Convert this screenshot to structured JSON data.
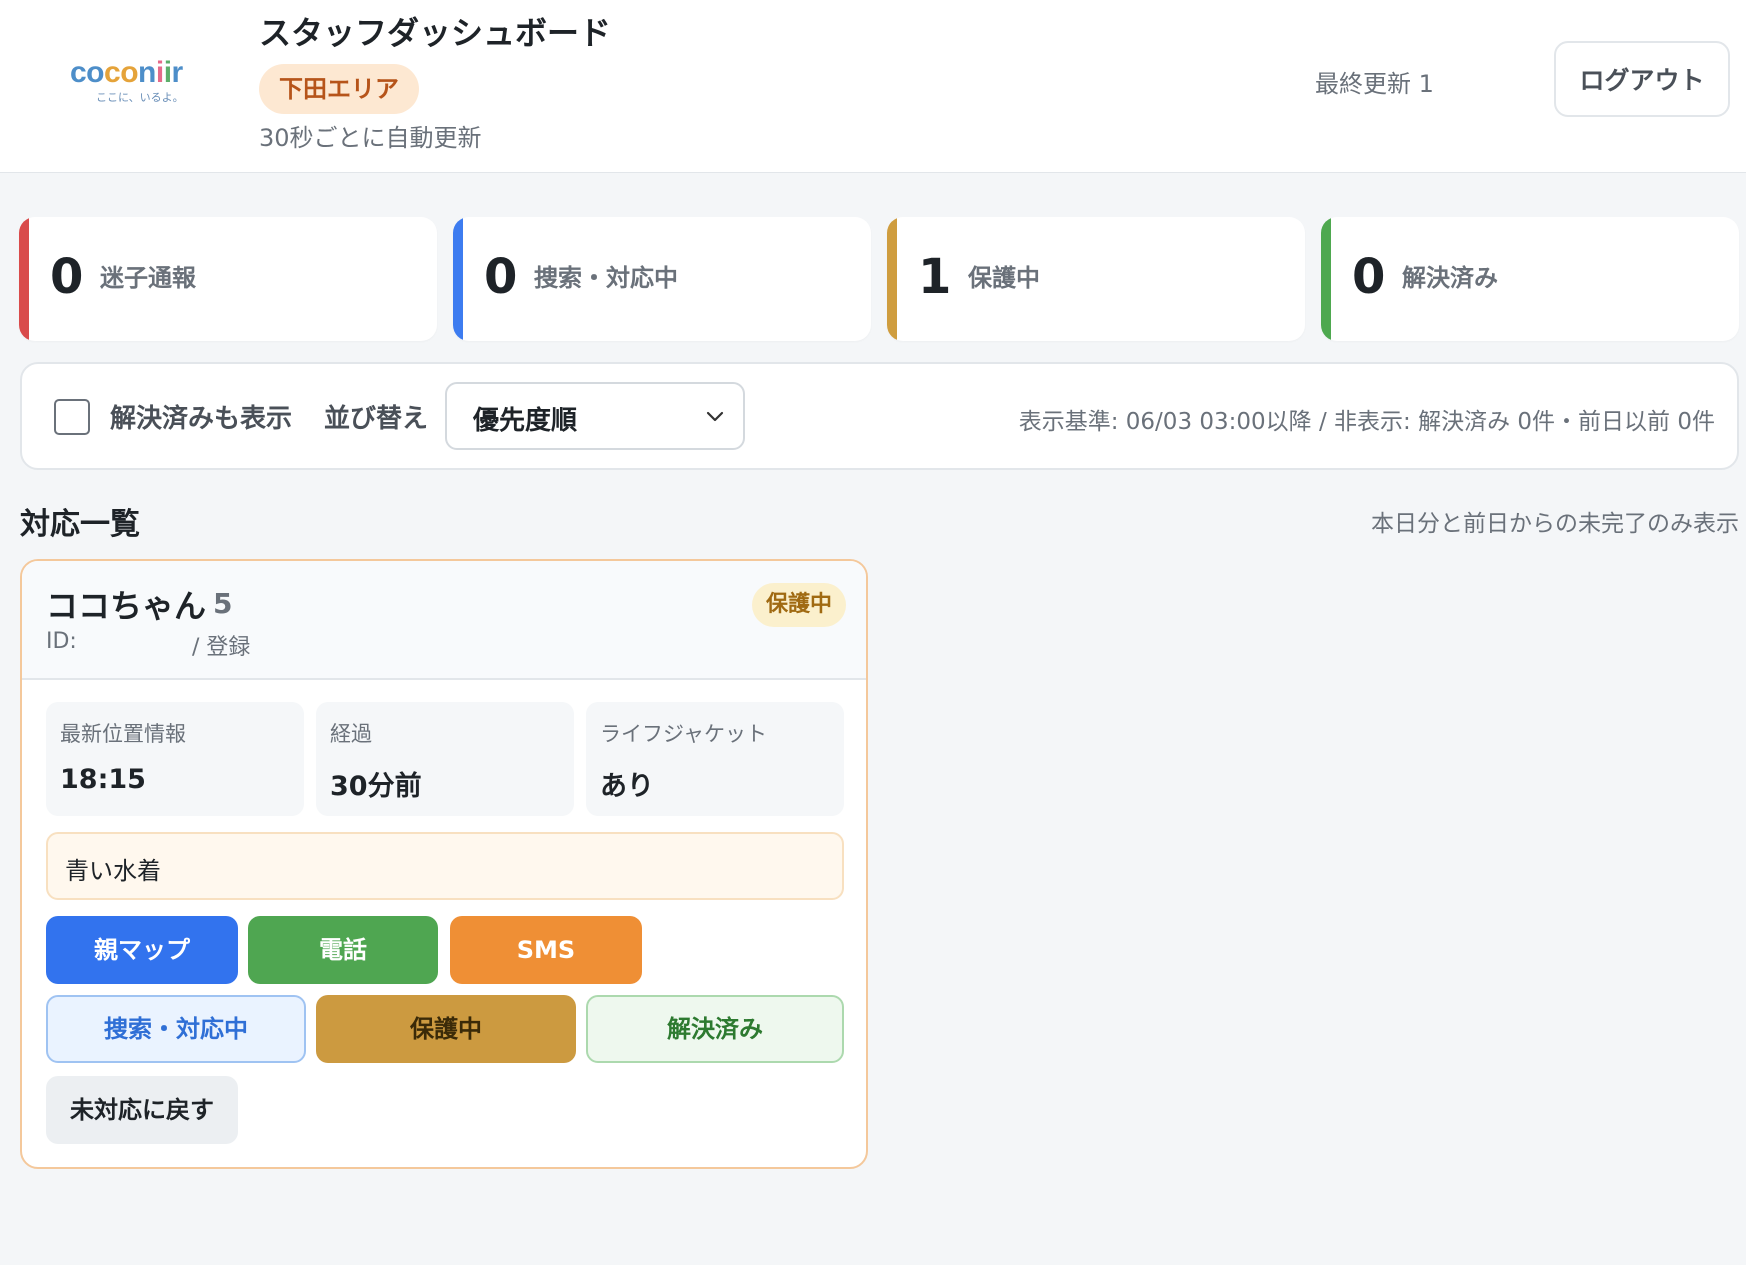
{
  "header": {
    "logo": {
      "text": "coconiir",
      "tagline": "ここに、いるよ。"
    },
    "title": "スタッフダッシュボード",
    "area": "下田エリア",
    "auto_refresh": "30秒ごとに自動更新",
    "last_updated": "最終更新 1",
    "logout_label": "ログアウト"
  },
  "stats": [
    {
      "count": "0",
      "label": "迷子通報",
      "color": "#d94b4b"
    },
    {
      "count": "0",
      "label": "捜索・対応中",
      "color": "#3d7cf0"
    },
    {
      "count": "1",
      "label": "保護中",
      "color": "#cf9d3f"
    },
    {
      "count": "0",
      "label": "解決済み",
      "color": "#4ea84f"
    }
  ],
  "filter": {
    "show_resolved_label": "解決済みも表示",
    "show_resolved_checked": false,
    "sort_label": "並び替え",
    "sort_value": "優先度順",
    "info": "表示基準: 06/03 03:00以降 / 非表示: 解決済み 0件・前日以前 0件"
  },
  "list": {
    "title": "対応一覧",
    "note": "本日分と前日からの未完了のみ表示"
  },
  "case": {
    "name": "ココちゃん",
    "age": "5",
    "id_label": "ID:",
    "registered_label": "/ 登録",
    "status": "保護中",
    "info": [
      {
        "key": "最新位置情報",
        "value": "18:15"
      },
      {
        "key": "経過",
        "value": "30分前"
      },
      {
        "key": "ライフジャケット",
        "value": "あり"
      }
    ],
    "note": "青い水着",
    "actions": {
      "map": "親マップ",
      "tel": "電話",
      "sms": "SMS",
      "searching": "捜索・対応中",
      "protected": "保護中",
      "resolved": "解決済み",
      "revert": "未対応に戻す"
    }
  }
}
